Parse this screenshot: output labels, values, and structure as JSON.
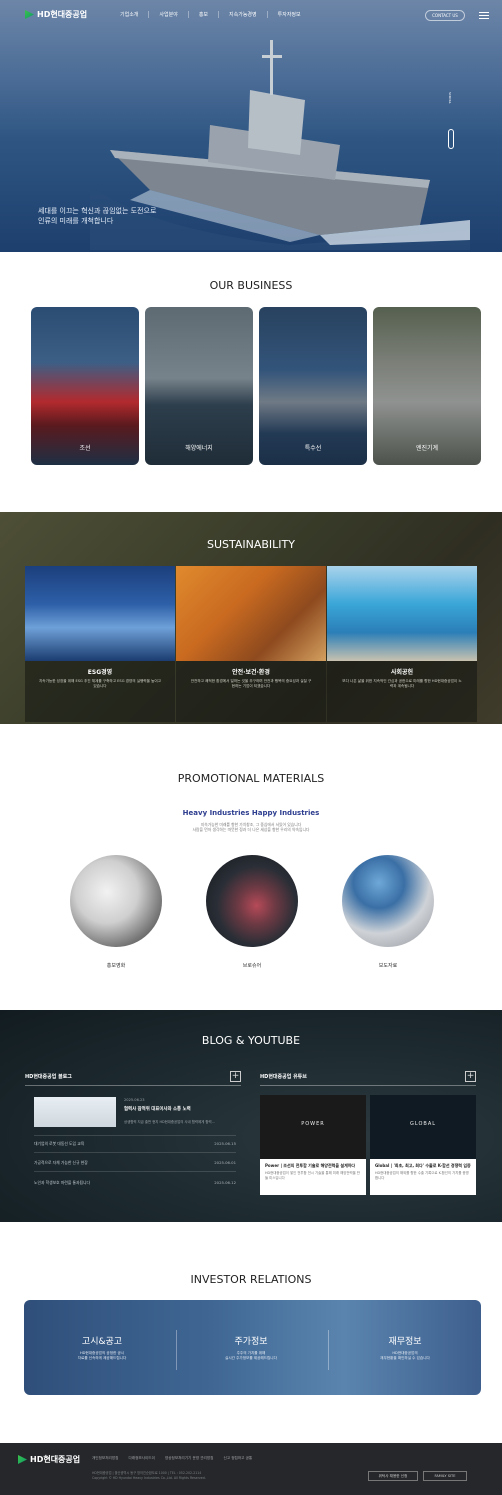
{
  "header": {
    "logo": "HD현대중공업",
    "menu": [
      "기업소개",
      "사업분야",
      "홍보",
      "지속가능경영",
      "투자자정보"
    ],
    "contact": "CONTACT US"
  },
  "hero": {
    "line1": "세대를 이끄는 혁신과 끊임없는 도전으로",
    "line2": "인류의 미래를 개척합니다",
    "scroll": "SCROLL"
  },
  "business": {
    "title": "OUR BUSINESS",
    "cards": [
      "조선",
      "해양에너지",
      "특수선",
      "엔진기계"
    ]
  },
  "sustainability": {
    "title": "SUSTAINABILITY",
    "cards": [
      {
        "title": "ESG경영",
        "desc": "지속가능한 성장을 위해 ESG 추진 체계를 구축하고 ESG 경영의 실행력을 높이고 있습니다"
      },
      {
        "title": "안전·보건·환경",
        "desc": "안전하고 쾌적한 환경에서 일하는 것을 추구하며 안전과 행복의 중요성과 실질 구현하는 기업이 되겠습니다"
      },
      {
        "title": "사회공헌",
        "desc": "보다 나은 삶을 위한 지속적인 관심과 공헌으로 미래를 향한 HD현대중공업이 노력과 계속됩니다"
      }
    ]
  },
  "promotional": {
    "title": "PROMOTIONAL MATERIALS",
    "subtitle": "Heavy Industries Happy Industries",
    "desc1": "지속가능한 미래를 향한 가치창조, 그 중심에서 서있어 있습니다",
    "desc2": "사람을 먼저 생각하는 따뜻한 정과 더 나은 세상을 향한 우리의 약속입니다",
    "items": [
      "홍보영화",
      "브로슈어",
      "보도자료"
    ]
  },
  "blog": {
    "title": "BLOG & YOUTUBE",
    "blog_head": "HD현대중공업 블로그",
    "youtube_head": "HD현대중공업 유튜브",
    "featured": {
      "date": "2025.06.23",
      "title": "협력사 잠적위 대표이사와 소통 노력",
      "desc": "상생협력 지급 출판 현지 HD현대중공업의 사내 협력에게 합력..."
    },
    "rows": [
      {
        "title": "대기업의 로봇 대동선 도입 교육",
        "date": "2025.06.15"
      },
      {
        "title": "가공적으로 자체 가능한 신규 현장",
        "date": "2025.06.01"
      },
      {
        "title": "노인과 학생보호 마련을 통과됩니다",
        "date": "2025.06.12"
      }
    ],
    "videos": [
      {
        "banner": "POWER",
        "title": "Power | 조선의 전투함 기술로 해양전력을 설계하다",
        "desc": "HD현대중공업이 쌓인 전투함 전시 기술을 통해 미래 해양전력을 만들 미스입니다"
      },
      {
        "banner": "GLOBAL",
        "title": "Global | '최초, 최고, 최다' 수출로 K-함선 경쟁력 입증",
        "desc": "HD현대중공업의 해외를 향한 수출 기록으로 K-함선의 가치를 증명합니다"
      }
    ]
  },
  "investor": {
    "title": "INVESTOR RELATIONS",
    "cols": [
      {
        "title": "고시&공고",
        "desc1": "HD현대중공업의 공정한 공시",
        "desc2": "자료를 신속하게 제공해드립니다"
      },
      {
        "title": "주가정보",
        "desc1": "주주의 가치를 위해",
        "desc2": "실시간 주가정보를 제공해드립니다"
      },
      {
        "title": "재무정보",
        "desc1": "HD현대중공업의",
        "desc2": "재무현황을 확인하실 수 있습니다"
      }
    ]
  },
  "footer": {
    "logo": "HD현대중공업",
    "links": [
      "개인정보처리방침",
      "다래정보사이드이",
      "영상정보처리기기 운영 관리방침",
      "신고 정립하고 공통"
    ],
    "addr": "HD현대중공업 | 울산광역시 동구 방어진순환도로 1000 | TEL : 052-202-2114",
    "copy": "Copyright © HD Hyundai Heavy Industries Co.,Ltd. All Rights Reserved.",
    "btn1": "위탁사 채용한 신청",
    "btn2": "FAMILY SITE"
  },
  "colors": {
    "accent": "#2d3d8f",
    "green": "#2dbb4e",
    "footer": "#25272a"
  }
}
